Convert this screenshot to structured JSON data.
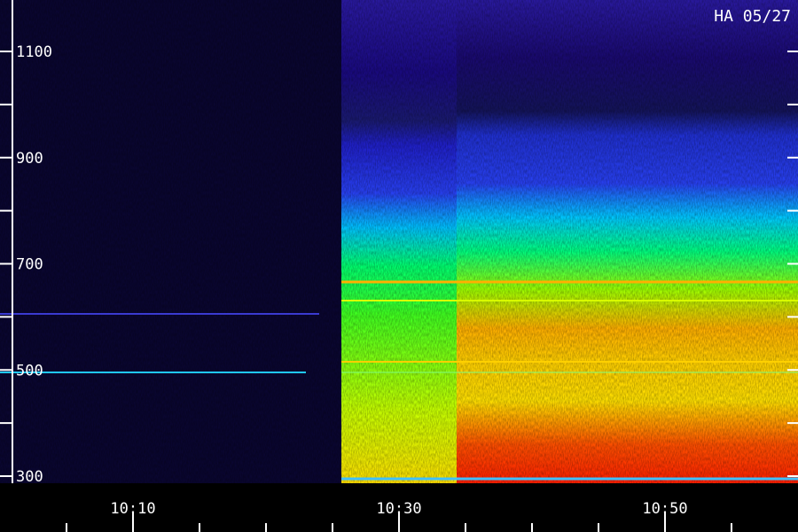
{
  "chart_data": {
    "type": "heatmap",
    "title": "HA 05/27",
    "xlabel": "",
    "ylabel": "",
    "x_ticks": [
      "10:10",
      "10:30",
      "10:50"
    ],
    "y_ticks": [
      "300",
      "500",
      "700",
      "900",
      "1100"
    ],
    "y_range": [
      300,
      1100
    ],
    "x_range": [
      "10:10",
      "10:50"
    ],
    "colormap": [
      "#000000",
      "#1a0a8a",
      "#2a2ae0",
      "#00c8ff",
      "#00ff80",
      "#d8ff00",
      "#ffa000",
      "#ff2000"
    ],
    "events": [
      {
        "name": "",
        "time": "10:25",
        "note": ""
      },
      {
        "name": "",
        "time": "10:34",
        "note": ""
      }
    ]
  }
}
